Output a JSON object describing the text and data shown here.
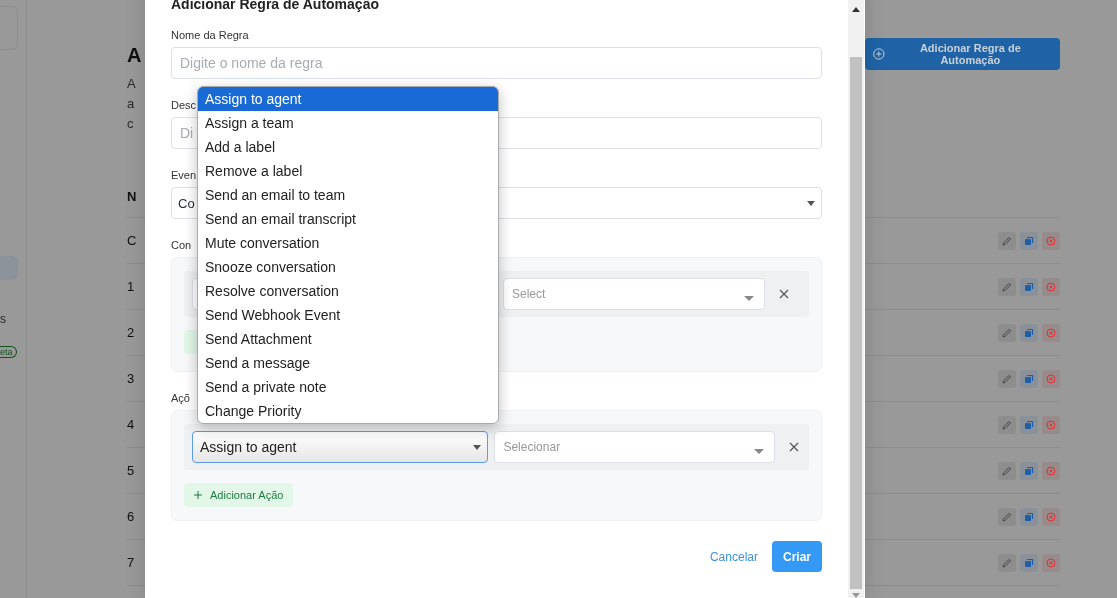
{
  "page": {
    "title": "A",
    "description_lines": [
      "A",
      "a",
      "c"
    ],
    "add_button": "Adicionar Regra de Automação",
    "sidebar": {
      "item_label": "s",
      "badge": "eta"
    },
    "table": {
      "header": "N",
      "rows": [
        {
          "name": "C"
        },
        {
          "name": "1"
        },
        {
          "name": "2"
        },
        {
          "name": "3"
        },
        {
          "name": "4"
        },
        {
          "name": "5"
        },
        {
          "name": "6"
        },
        {
          "name": "7"
        }
      ]
    }
  },
  "modal": {
    "title": "Adicionar Regra de Automação",
    "fields": [
      {
        "kind": "text",
        "label": "Nome da Regra",
        "placeholder": "Digite o nome da regra"
      },
      {
        "kind": "text",
        "label": "Desc",
        "placeholder": "Di"
      },
      {
        "kind": "select",
        "label": "Even",
        "value": "Co"
      }
    ],
    "conditions": {
      "label": "Con",
      "rows": [
        {
          "value_placeholder": "Select"
        }
      ]
    },
    "actions": {
      "label": "Açõ",
      "rows": [
        {
          "action": "Assign to agent",
          "value_placeholder": "Selecionar"
        }
      ],
      "add_button": "Adicionar Ação"
    },
    "dropdown": {
      "options": [
        {
          "label": "Assign to agent",
          "selected": true
        },
        {
          "label": "Assign a team",
          "selected": false
        },
        {
          "label": "Add a label",
          "selected": false
        },
        {
          "label": "Remove a label",
          "selected": false
        },
        {
          "label": "Send an email to team",
          "selected": false
        },
        {
          "label": "Send an email transcript",
          "selected": false
        },
        {
          "label": "Mute conversation",
          "selected": false
        },
        {
          "label": "Snooze conversation",
          "selected": false
        },
        {
          "label": "Resolve conversation",
          "selected": false
        },
        {
          "label": "Send Webhook Event",
          "selected": false
        },
        {
          "label": "Send Attachment",
          "selected": false
        },
        {
          "label": "Send a message",
          "selected": false
        },
        {
          "label": "Send a private note",
          "selected": false
        },
        {
          "label": "Change Priority",
          "selected": false
        }
      ]
    },
    "buttons": {
      "cancel": "Cancelar",
      "submit": "Criar"
    }
  }
}
